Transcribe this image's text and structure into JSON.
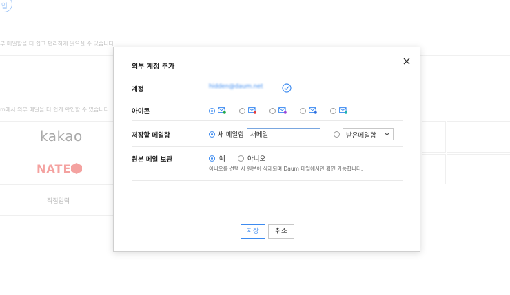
{
  "background": {
    "pill_label": "입",
    "desc_top": "부 메일함을 더 쉽고 편리하게 읽으실 수 있습니다.",
    "desc_mid": "m에서 외부 메일을 더 쉽게 확인할 수 있습니다.",
    "providers": {
      "kakao": "kakao",
      "nate": "NATE",
      "direct": "직접입력"
    }
  },
  "dialog": {
    "title": "외부 계정 추가",
    "close_icon": "close-icon",
    "rows": {
      "account": {
        "label": "계정",
        "value": "hidden@daum.net",
        "verify_icon": "check-circle-icon"
      },
      "icon": {
        "label": "아이콘",
        "colors": [
          "#22a84a",
          "#e53b3b",
          "#9b45d8",
          "#2d6fe0",
          "#20b4b0"
        ],
        "selected_index": 0
      },
      "folder": {
        "label": "저장할 메일함",
        "new_option_label": "새 메일함",
        "new_folder_value": "새메일",
        "existing_select_value": "받은메일함",
        "selected": "new"
      },
      "keep_original": {
        "label": "원본 메일 보관",
        "yes_label": "예",
        "no_label": "아니오",
        "selected": "yes",
        "notice": "아니오를 선택 시 원본이 삭제되며 Daum 메일에서만 확인 가능합니다."
      }
    },
    "buttons": {
      "save": "저장",
      "cancel": "취소"
    },
    "accent_color": "#3d8bf0"
  }
}
